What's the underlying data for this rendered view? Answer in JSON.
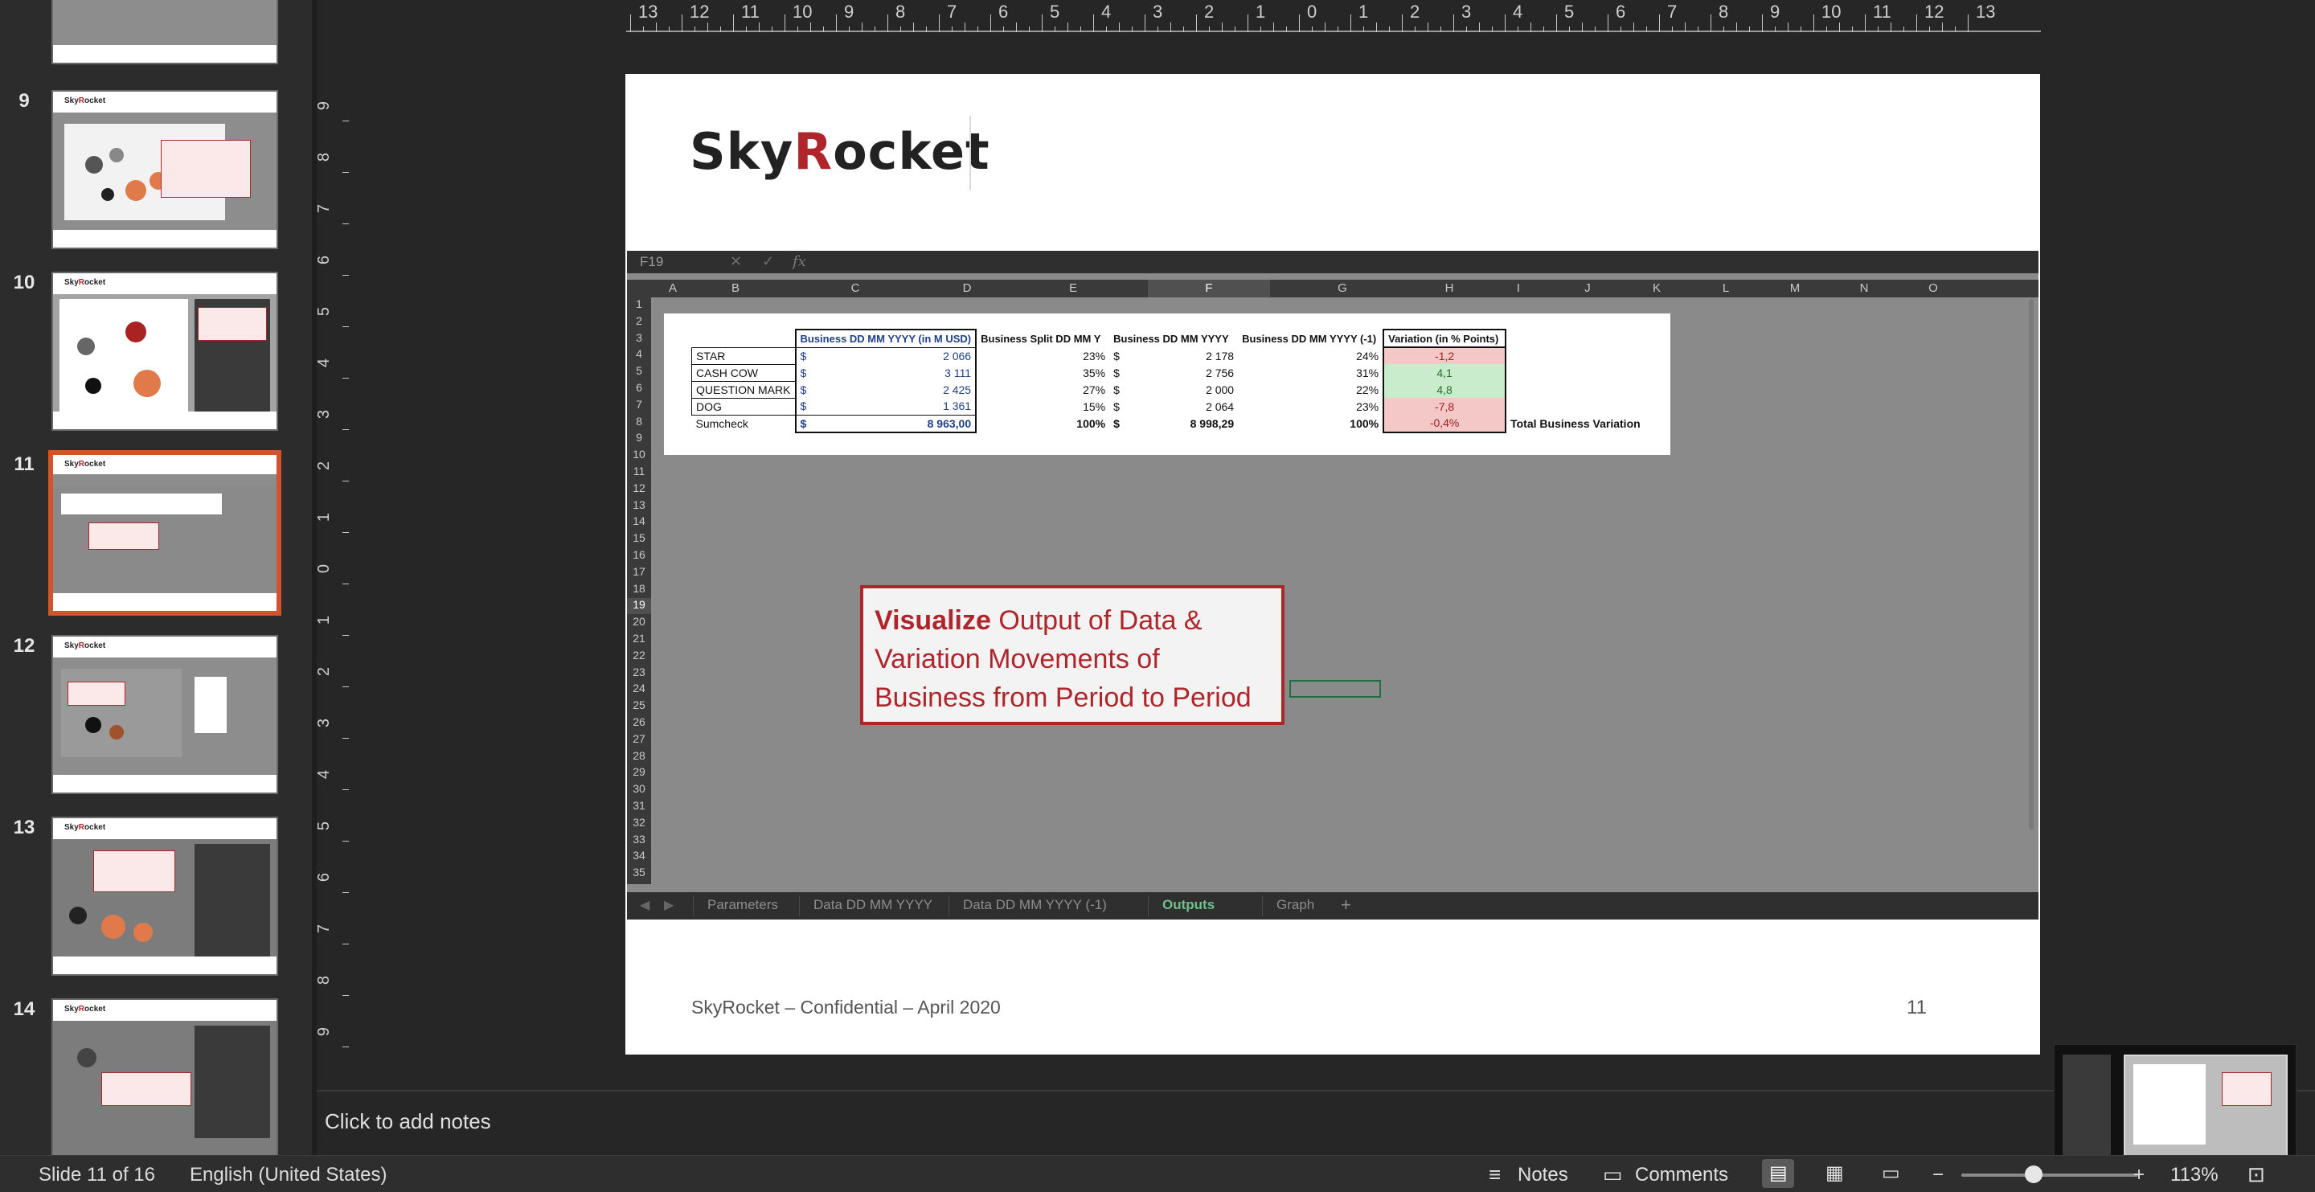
{
  "thumbnails": [
    {
      "num": "9"
    },
    {
      "num": "10"
    },
    {
      "num": "11"
    },
    {
      "num": "12"
    },
    {
      "num": "13"
    },
    {
      "num": "14"
    }
  ],
  "ruler": {
    "h_labels": [
      "13",
      "12",
      "11",
      "10",
      "9",
      "8",
      "7",
      "6",
      "5",
      "4",
      "3",
      "2",
      "1",
      "0",
      "1",
      "2",
      "3",
      "4",
      "5",
      "6",
      "7",
      "8",
      "9",
      "10",
      "11",
      "12",
      "13"
    ],
    "v_labels": [
      "9",
      "8",
      "7",
      "6",
      "5",
      "4",
      "3",
      "2",
      "1",
      "0",
      "1",
      "2",
      "3",
      "4",
      "5",
      "6",
      "7",
      "8",
      "9"
    ]
  },
  "slide": {
    "logo_part1": "Sky",
    "logo_r": "R",
    "logo_part2": "ocket",
    "footer": "SkyRocket – Confidential – April 2020",
    "number": "11"
  },
  "excel": {
    "cell_ref": "F19",
    "fx_cancel": "✕",
    "fx_confirm": "✓",
    "fx": "fx",
    "columns": [
      "A",
      "B",
      "C",
      "D",
      "E",
      "F",
      "G",
      "H",
      "I",
      "J",
      "K",
      "L",
      "M",
      "N",
      "O"
    ],
    "selected_column": "F",
    "rows": [
      "1",
      "2",
      "3",
      "4",
      "5",
      "6",
      "7",
      "8",
      "9",
      "10",
      "11",
      "12",
      "13",
      "14",
      "15",
      "16",
      "17",
      "18",
      "19",
      "20",
      "21",
      "22",
      "23",
      "24",
      "25",
      "26",
      "27",
      "28",
      "29",
      "30",
      "31",
      "32",
      "33",
      "34",
      "35"
    ],
    "selected_row": "19",
    "headers": {
      "c": "Business DD MM YYYY (in M USD)",
      "d": "Business Split DD MM Y",
      "e": "Business DD MM YYYY",
      "f": "Business DD MM YYYY (-1)",
      "g": "Variation (in % Points)"
    },
    "table": [
      {
        "label": "STAR",
        "cur": "$",
        "val": "2 066",
        "split": "23%",
        "cur2": "$",
        "val2": "2 178",
        "split2": "24%",
        "var": "-1,2",
        "sign": "neg"
      },
      {
        "label": "CASH COW",
        "cur": "$",
        "val": "3 111",
        "split": "35%",
        "cur2": "$",
        "val2": "2 756",
        "split2": "31%",
        "var": "4,1",
        "sign": "pos"
      },
      {
        "label": "QUESTION MARK",
        "cur": "$",
        "val": "2 425",
        "split": "27%",
        "cur2": "$",
        "val2": "2 000",
        "split2": "22%",
        "var": "4,8",
        "sign": "pos"
      },
      {
        "label": "DOG",
        "cur": "$",
        "val": "1 361",
        "split": "15%",
        "cur2": "$",
        "val2": "2 064",
        "split2": "23%",
        "var": "-7,8",
        "sign": "neg"
      }
    ],
    "sumcheck": {
      "label": "Sumcheck",
      "cur": "$",
      "val": "8 963,00",
      "split": "100%",
      "cur2": "$",
      "val2": "8 998,29",
      "split2": "100%",
      "var": "-0,4%",
      "note": "Total Business Variation"
    },
    "callout_bold": "Visualize",
    "callout_line1": " Output of Data &",
    "callout_line2": "Variation Movements of",
    "callout_line3": "Business from Period to Period",
    "sheet_tabs": [
      "Parameters",
      "Data DD MM YYYY",
      "Data DD MM YYYY (-1)",
      "Outputs",
      "Graph"
    ],
    "active_tab": "Outputs",
    "add_tab": "+"
  },
  "notes": {
    "placeholder": "Click to add notes"
  },
  "statusbar": {
    "slide_count": "Slide 11 of 16",
    "language": "English (United States)",
    "notes_label": "Notes",
    "comments_label": "Comments",
    "zoom_minus": "−",
    "zoom_plus": "+",
    "zoom_level": "113%",
    "zoom_fraction": 0.41
  },
  "colors": {
    "accent_selected": "#d2542d",
    "brand_red": "#b0252a",
    "active_sheet_tab": "#6ec08a"
  }
}
